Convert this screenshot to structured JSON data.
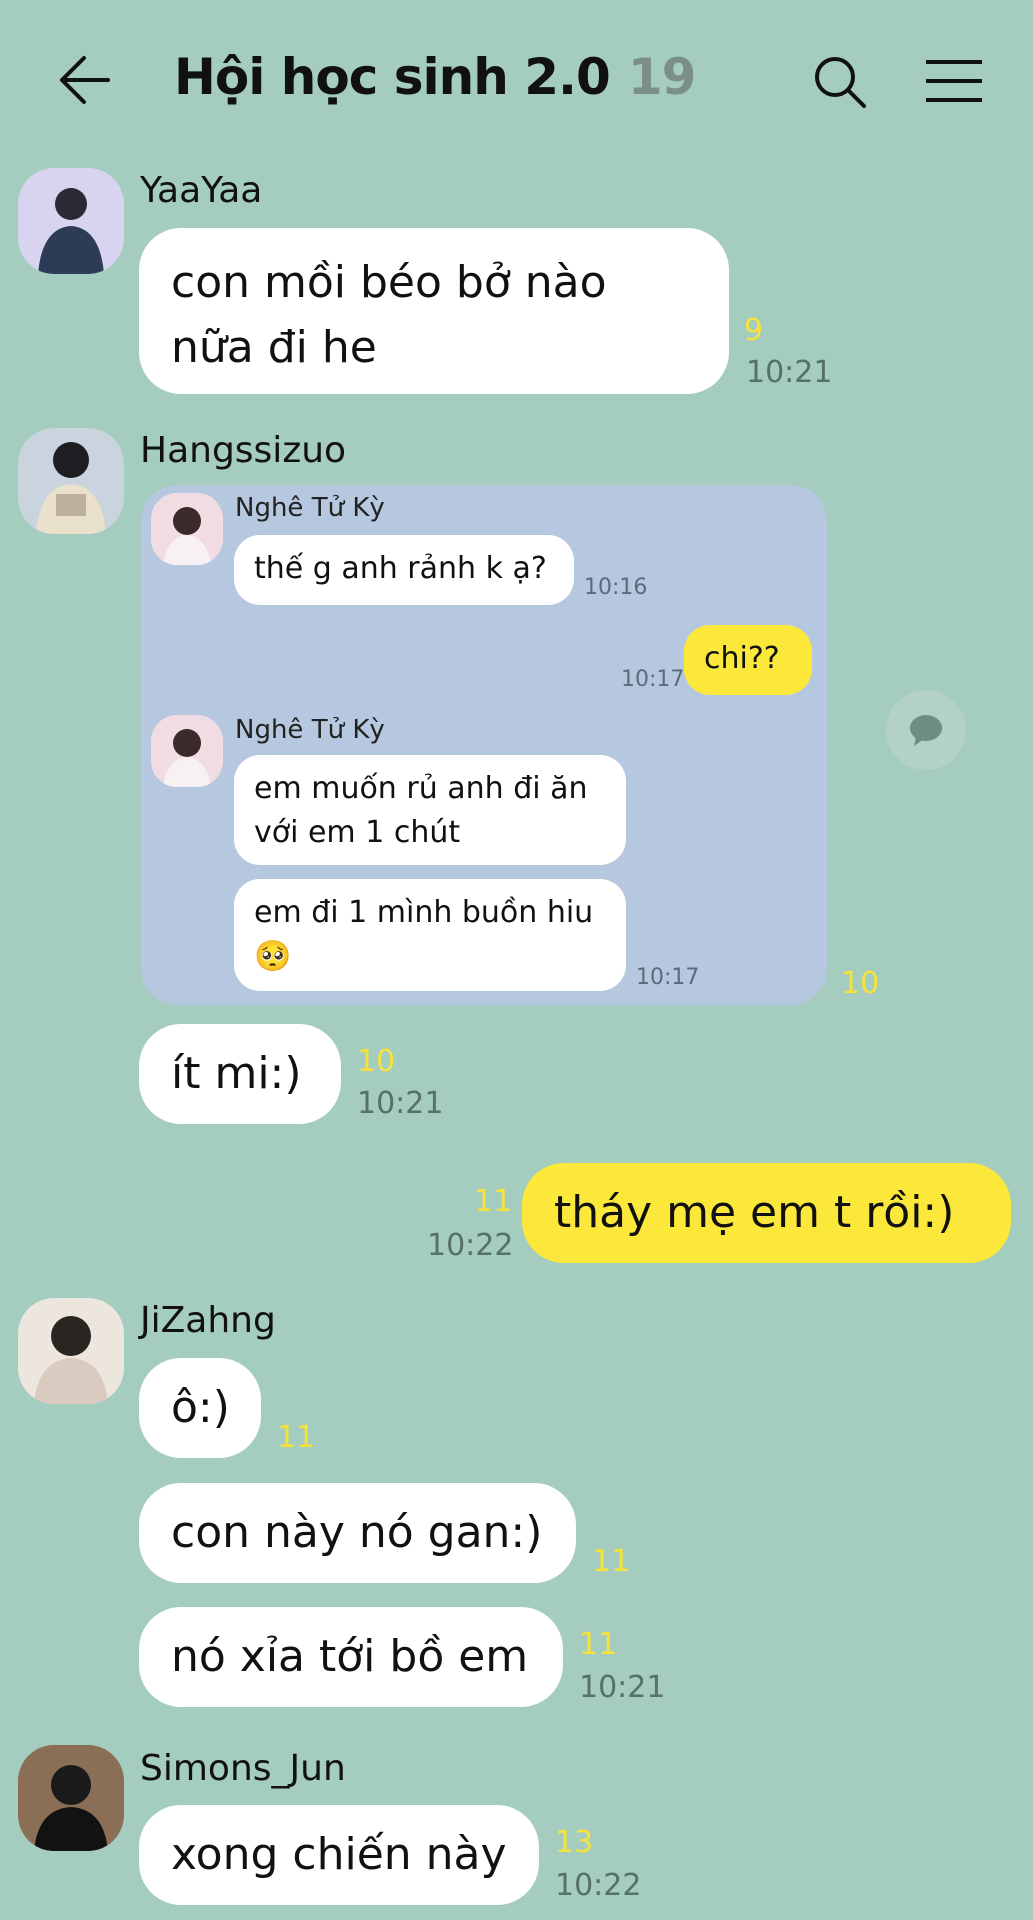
{
  "header": {
    "title": "Hội học sinh 2.0",
    "member_count": "19",
    "back_icon": "arrow-left-icon",
    "search_icon": "search-icon",
    "menu_icon": "hamburger-menu-icon"
  },
  "messages": {
    "m1": {
      "sender": "YaaYaa",
      "line1": "con mồi béo bở nào",
      "line2": "nữa đi he",
      "unread": "9",
      "time": "10:21"
    },
    "m2": {
      "sender": "Hangssizuo",
      "quote": {
        "q1_sender": "Nghê Tử Kỳ",
        "q1_text": "thế g anh rảnh k ạ?",
        "q1_time": "10:16",
        "q2_text": "chi??",
        "q2_time": "10:17",
        "q3_sender": "Nghê Tử Kỳ",
        "q3_line1": "em muốn rủ anh đi ăn",
        "q3_line2": "với em 1 chút",
        "q4_line1": "em đi 1 mình buồn hiu",
        "q4_emoji": "🥺",
        "q4_time": "10:17"
      },
      "quote_unread": "10",
      "text": "ít mi:)",
      "unread": "10",
      "time": "10:21"
    },
    "m3": {
      "text": "tháy mẹ em t rồi:)",
      "unread": "11",
      "time": "10:22"
    },
    "m4": {
      "sender": "JiZahng",
      "t1": "ô:)",
      "u1": "11",
      "t2": "con này nó gan:)",
      "u2": "11",
      "t3": "nó xỉa tới bồ em",
      "u3": "11",
      "time": "10:21"
    },
    "m5": {
      "sender": "Simons_Jun",
      "text": "xong chiến này",
      "unread": "13",
      "time": "10:22"
    }
  },
  "colors": {
    "background": "#a4cdbf",
    "bubble": "#ffffff",
    "my_bubble": "#fce83a",
    "unread": "#f6e23b",
    "quote_box": "#b6c8df"
  }
}
